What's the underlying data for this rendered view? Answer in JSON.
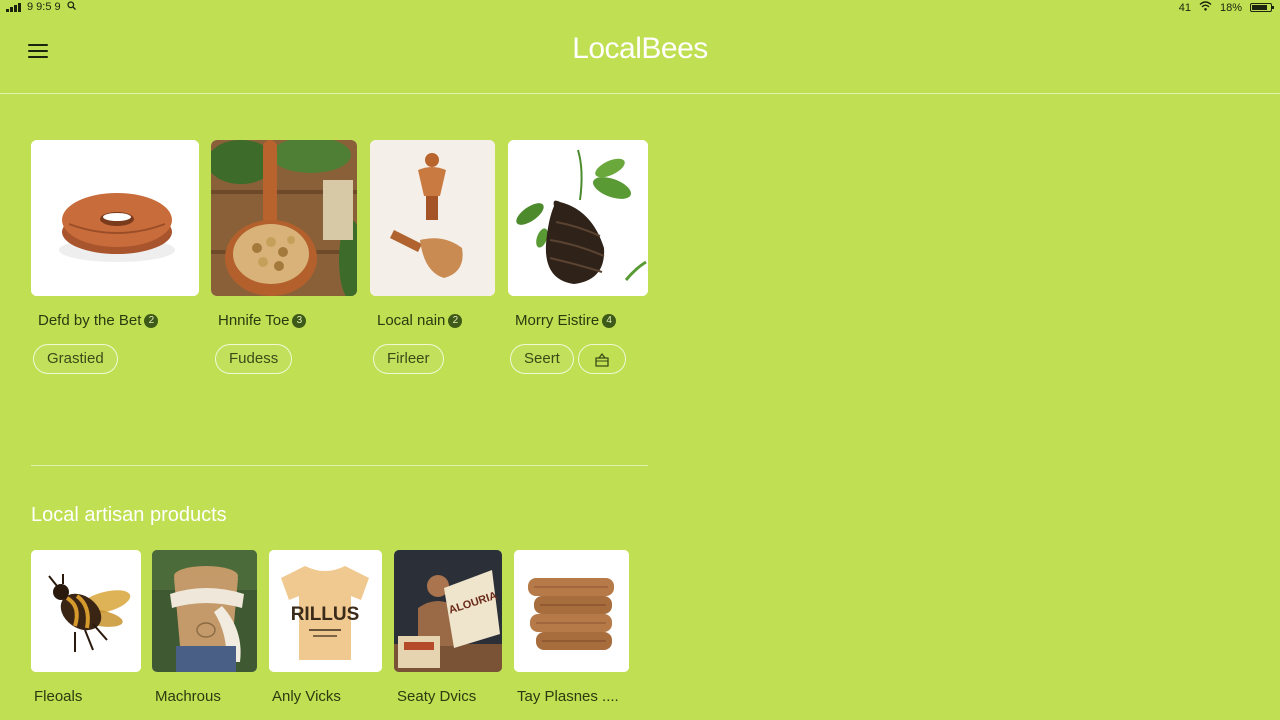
{
  "status_bar": {
    "left_text": "9 9:5 9",
    "right_signal": "41",
    "battery_percent": "18%"
  },
  "header": {
    "title": "LocalBees"
  },
  "featured": [
    {
      "title": "Defd by the Bet",
      "badge": "2",
      "buttons": [
        "Grastied"
      ]
    },
    {
      "title": "Hnnife Toe",
      "badge": "3",
      "buttons": [
        "Fudess"
      ]
    },
    {
      "title": "Local nain",
      "badge": "2",
      "buttons": [
        "Firleer"
      ]
    },
    {
      "title": "Morry Eistire",
      "badge": "4",
      "buttons": [
        "Seert"
      ],
      "icon_button": "share-box-icon"
    }
  ],
  "section": {
    "title": "Local artisan products"
  },
  "products": [
    {
      "label": "Fleoals"
    },
    {
      "label": "Machrous"
    },
    {
      "label": "Anly Vicks"
    },
    {
      "label": "Seaty Dvics"
    },
    {
      "label": "Tay Plasnes ...."
    }
  ],
  "product_images": {
    "tshirt_text": "RILLUS",
    "box_text": "ALOURIA"
  },
  "colors": {
    "background": "#c0df52",
    "badge": "#3e5a18",
    "title_text": "#ffffff"
  }
}
